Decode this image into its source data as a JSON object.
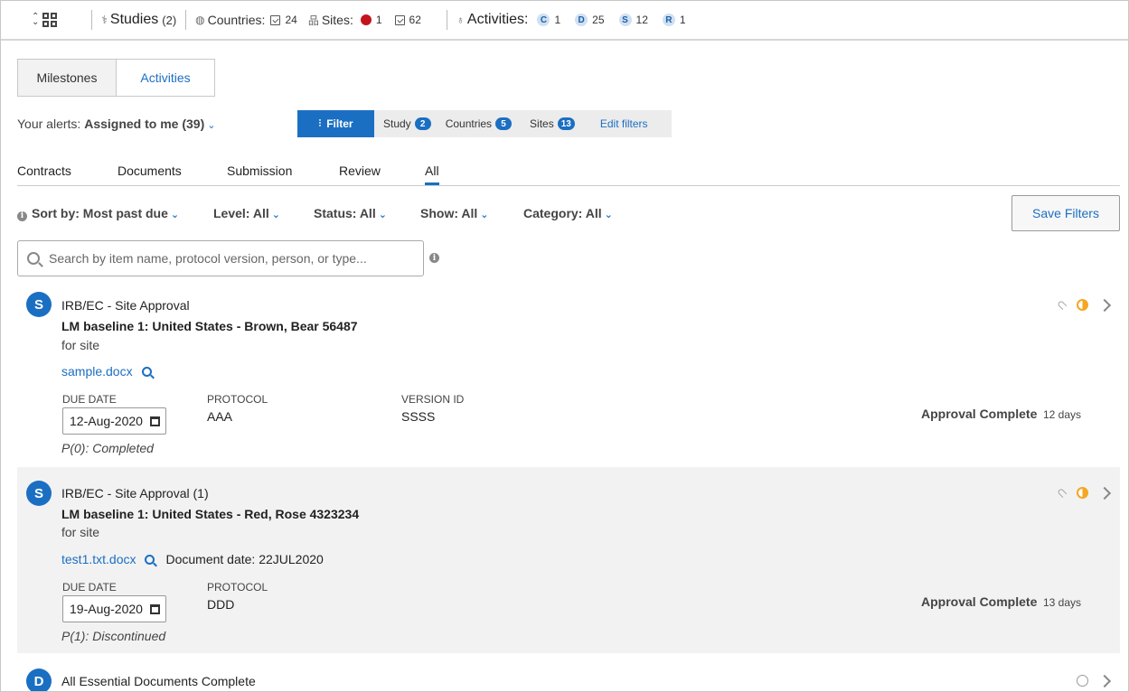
{
  "topbar": {
    "studies_label": "Studies",
    "studies_count": "(2)",
    "countries_label": "Countries:",
    "countries_count": "24",
    "sites_label": "Sites:",
    "sites_alert_count": "1",
    "sites_count": "62",
    "activities_label": "Activities:",
    "activities": [
      {
        "letter": "C",
        "count": "1"
      },
      {
        "letter": "D",
        "count": "25"
      },
      {
        "letter": "S",
        "count": "12"
      },
      {
        "letter": "R",
        "count": "1"
      }
    ]
  },
  "view_tabs": {
    "milestones": "Milestones",
    "activities": "Activities"
  },
  "alerts": {
    "prefix": "Your alerts:",
    "value": "Assigned to me (39)"
  },
  "filterbar": {
    "filter_label": "Filter",
    "study_label": "Study",
    "study_count": "2",
    "countries_label": "Countries",
    "countries_count": "5",
    "sites_label": "Sites",
    "sites_count": "13",
    "edit_label": "Edit filters"
  },
  "category_tabs": [
    "Contracts",
    "Documents",
    "Submission",
    "Review",
    "All"
  ],
  "sort": {
    "sort_by": "Sort by: Most past due",
    "level": "Level: All",
    "status": "Status: All",
    "show": "Show: All",
    "category": "Category: All",
    "save_filters": "Save Filters"
  },
  "search": {
    "placeholder": "Search by item name, protocol version, person, or type..."
  },
  "cards": [
    {
      "avatar": "S",
      "title": "IRB/EC - Site Approval",
      "subtitle": "LM baseline 1: United States - Brown, Bear 56487",
      "for_text": "for site",
      "file": "sample.docx",
      "document_date": "",
      "due_label": "DUE DATE",
      "due_date": "12-Aug-2020",
      "protocol_label": "PROTOCOL",
      "protocol": "AAA",
      "version_label": "VERSION ID",
      "version": "SSSS",
      "pstatus": "P(0): Completed",
      "approval": "Approval Complete",
      "days": "12 days"
    },
    {
      "avatar": "S",
      "title": "IRB/EC - Site Approval (1)",
      "subtitle": "LM baseline 1: United States - Red, Rose 4323234",
      "for_text": "for site",
      "file": "test1.txt.docx",
      "document_date": "Document date: 22JUL2020",
      "due_label": "DUE DATE",
      "due_date": "19-Aug-2020",
      "protocol_label": "PROTOCOL",
      "protocol": "DDD",
      "pstatus": "P(1): Discontinued",
      "approval": "Approval Complete",
      "days": "13 days"
    },
    {
      "avatar": "D",
      "title": "All Essential Documents Complete"
    }
  ],
  "colors": {
    "accent": "#1b6fc2",
    "alert_red": "#c3141e",
    "in_progress": "#f5a623"
  }
}
